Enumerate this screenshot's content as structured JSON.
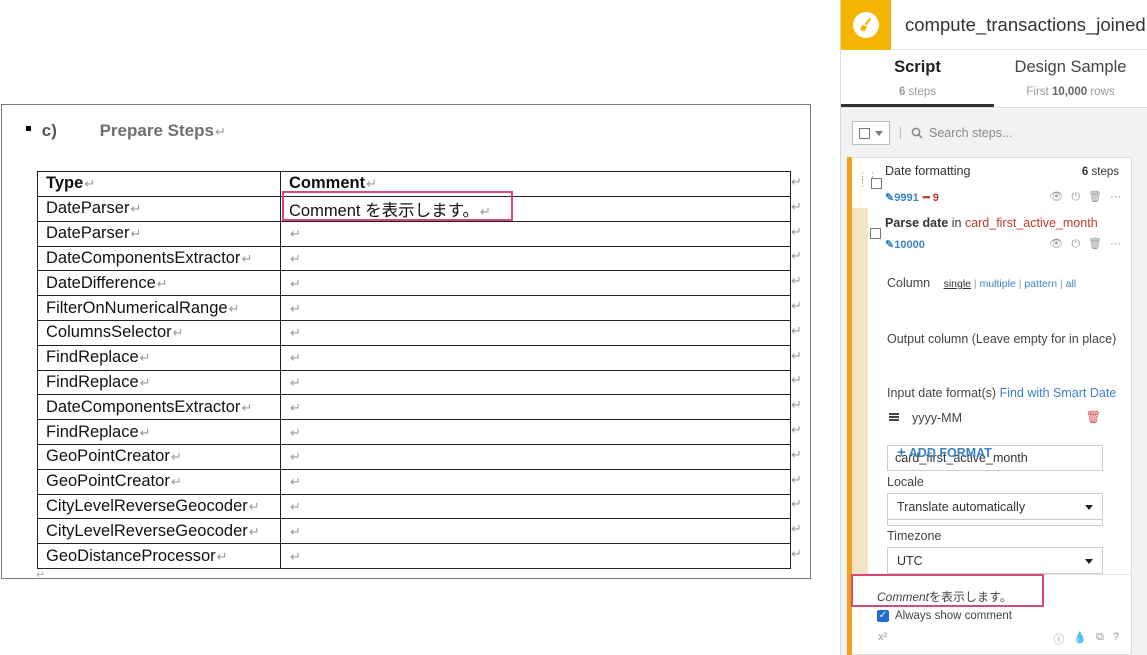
{
  "doc": {
    "heading_letter": "c)",
    "heading_text": "Prepare Steps",
    "return_mark": "↵",
    "table": {
      "headers": [
        "Type",
        "Comment"
      ],
      "rows": [
        {
          "type": "DateParser",
          "comment": "Comment を表示します。"
        },
        {
          "type": "DateParser",
          "comment": ""
        },
        {
          "type": "DateComponentsExtractor",
          "comment": ""
        },
        {
          "type": "DateDifference",
          "comment": ""
        },
        {
          "type": "FilterOnNumericalRange",
          "comment": ""
        },
        {
          "type": "ColumnsSelector",
          "comment": ""
        },
        {
          "type": "FindReplace",
          "comment": ""
        },
        {
          "type": "FindReplace",
          "comment": ""
        },
        {
          "type": "DateComponentsExtractor",
          "comment": ""
        },
        {
          "type": "FindReplace",
          "comment": ""
        },
        {
          "type": "GeoPointCreator",
          "comment": ""
        },
        {
          "type": "GeoPointCreator",
          "comment": ""
        },
        {
          "type": "CityLevelReverseGeocoder",
          "comment": ""
        },
        {
          "type": "CityLevelReverseGeocoder",
          "comment": ""
        },
        {
          "type": "GeoDistanceProcessor",
          "comment": ""
        }
      ]
    }
  },
  "panel": {
    "title": "compute_transactions_joined",
    "tabs": [
      {
        "label": "Script",
        "sub_count": "6",
        "sub_text": "steps"
      },
      {
        "label": "Design Sample",
        "sub_prefix": "First",
        "sub_count": "10,000",
        "sub_suffix": "rows"
      }
    ],
    "search_placeholder": "Search steps...",
    "group": {
      "name": "Date formatting",
      "count": "6",
      "count_label": "steps",
      "stat_blue": "9991",
      "stat_red": "9"
    },
    "step": {
      "action": "Parse date",
      "in": "in",
      "column": "card_first_active_month",
      "stat_blue": "10000",
      "column_label": "Column",
      "modes": [
        "single",
        "multiple",
        "pattern",
        "all"
      ],
      "column_value": "card_first_active_month",
      "output_label": "Output column (Leave empty for in place)",
      "output_value": "",
      "formats_label": "Input date format(s)",
      "smart_date_link": "Find with Smart Date",
      "format_value": "yyyy-MM",
      "add_format": "ADD FORMAT",
      "locale_label": "Locale",
      "locale_value": "Translate automatically",
      "timezone_label": "Timezone",
      "timezone_value": "UTC"
    },
    "comment": {
      "italic": "Comment",
      "rest": "を表示します。",
      "always_show": "Always show comment"
    }
  },
  "colors": {
    "highlight": "#d9487d",
    "accent_orange": "#f1a21b",
    "logo_yellow": "#f4b400",
    "link_blue": "#3b82c6"
  }
}
